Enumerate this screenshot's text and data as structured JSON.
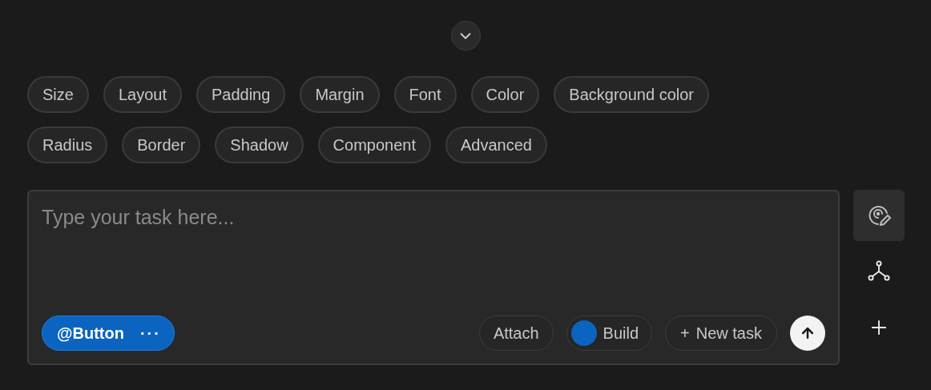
{
  "collapse_button": {
    "expanded": true
  },
  "chip_rows": [
    [
      "Size",
      "Layout",
      "Padding",
      "Margin",
      "Font",
      "Color",
      "Background color"
    ],
    [
      "Radius",
      "Border",
      "Shadow",
      "Component",
      "Advanced"
    ]
  ],
  "task_input": {
    "placeholder": "Type your task here..."
  },
  "context_tag": {
    "label": "@Button",
    "more": "···"
  },
  "actions": [
    {
      "kind": "button",
      "label": "Attach"
    },
    {
      "kind": "toggle",
      "label": "Build",
      "on": true
    },
    {
      "kind": "add",
      "icon": "+",
      "label": "New task"
    },
    {
      "kind": "send"
    }
  ],
  "side_tools": [
    {
      "kind": "target",
      "selected": true
    },
    {
      "kind": "graph",
      "selected": false
    },
    {
      "kind": "plus",
      "selected": false
    }
  ]
}
